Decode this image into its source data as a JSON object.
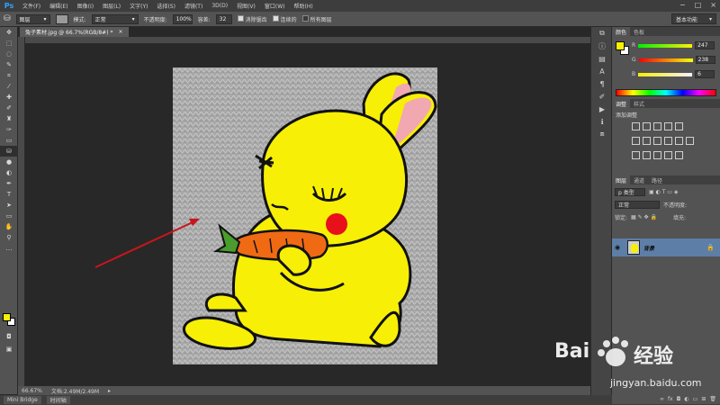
{
  "app": {
    "logo": "Ps"
  },
  "menu": [
    "文件(F)",
    "编辑(E)",
    "图像(I)",
    "图层(L)",
    "文字(Y)",
    "选择(S)",
    "滤镜(T)",
    "3D(D)",
    "视图(V)",
    "窗口(W)",
    "帮助(H)"
  ],
  "window_controls": [
    "−",
    "□",
    "×"
  ],
  "options": {
    "mode_preset": "图层",
    "mode_label": "模式:",
    "mode_value": "正常",
    "opacity_label": "不透明度:",
    "opacity_value": "100%",
    "tolerance_label": "容差:",
    "tolerance_value": "32",
    "antialias_label": "消除锯齿",
    "contiguous_label": "连续的",
    "all_layers_label": "所有图层",
    "workspace": "基本功能"
  },
  "document": {
    "tab_title": "兔子素材.jpg @ 66.7%(RGB/8#) *",
    "close": "×",
    "zoom": "66.67%",
    "doc_size": "文档:2.49M/2.49M"
  },
  "bottom_tabs": [
    "Mini Bridge",
    "时间轴"
  ],
  "color_panel": {
    "tabs": [
      "颜色",
      "色板"
    ],
    "r_label": "R",
    "r_value": "247",
    "g_label": "G",
    "g_value": "238",
    "b_label": "B",
    "b_value": "6",
    "fg_color": "#f7ef06"
  },
  "adjust_panel": {
    "tabs": [
      "调整",
      "样式"
    ],
    "title": "添加调整"
  },
  "layers_panel": {
    "tabs": [
      "图层",
      "通道",
      "路径"
    ],
    "filter_label": "p 类型",
    "blend_mode": "正常",
    "opacity_label": "不透明度:",
    "lock_label": "锁定:",
    "fill_label": "填充:",
    "layer_name": "背景"
  },
  "watermark": {
    "brand_text": "Bai",
    "brand_suffix": "经验",
    "url": "jingyan.baidu.com"
  },
  "colors": {
    "rabbit_yellow": "#f7ef06",
    "carrot_orange": "#f06a14",
    "cheek_red": "#e8101a",
    "ear_pink": "#f2a8b0",
    "arrow_red": "#c8161c"
  }
}
